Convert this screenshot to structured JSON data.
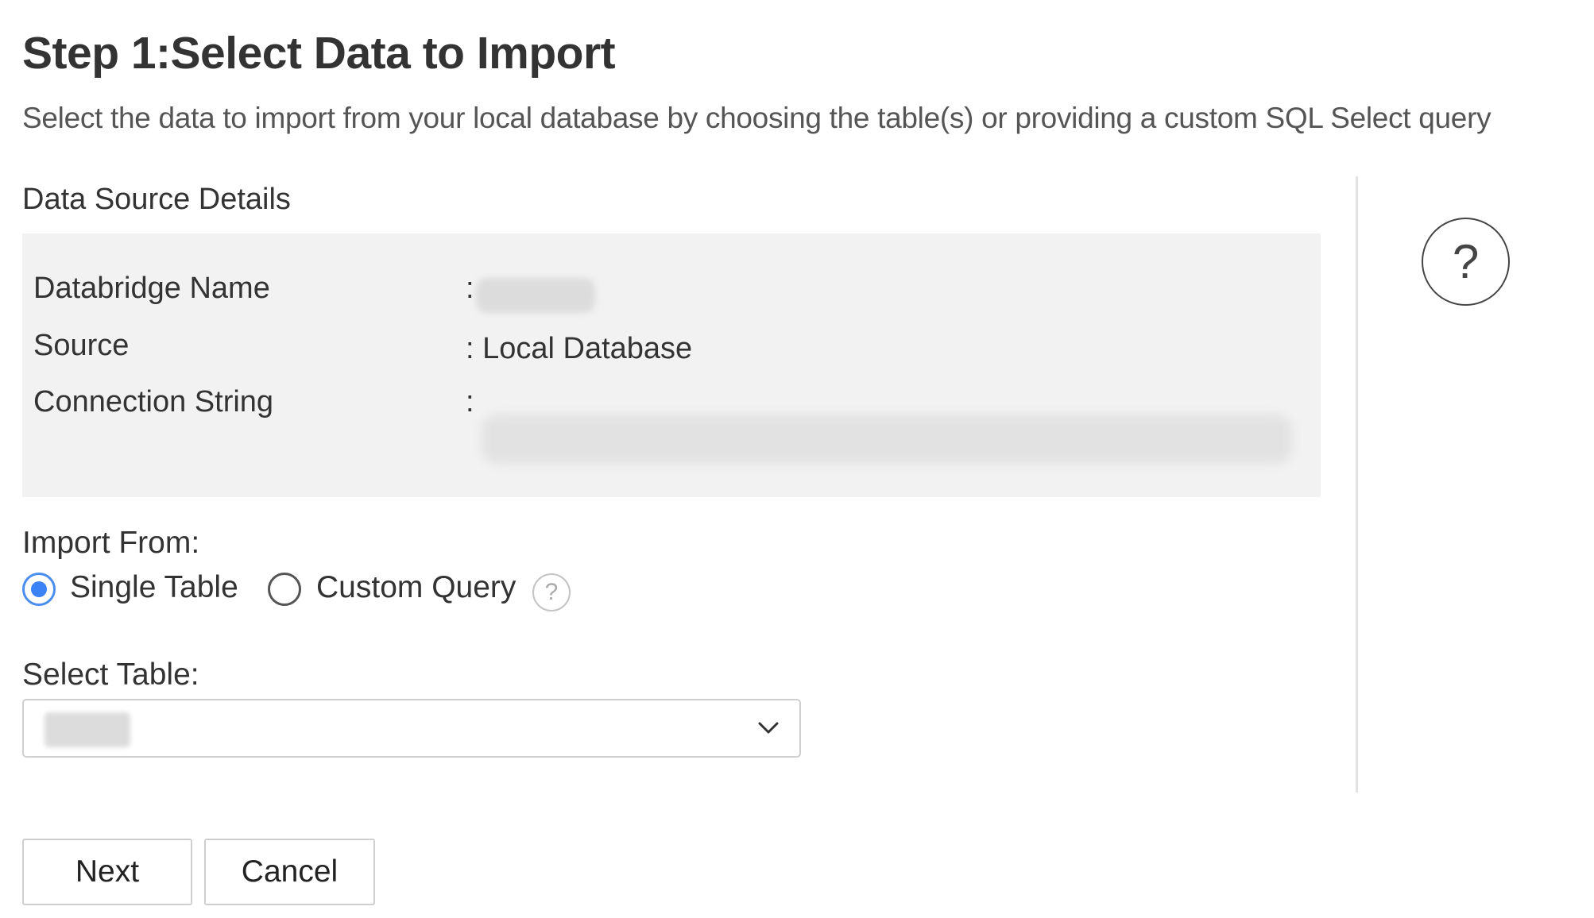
{
  "header": {
    "title": "Step 1:Select Data to Import",
    "subtitle": "Select the data to import from your local database by choosing the table(s) or providing a custom SQL Select query"
  },
  "details": {
    "heading": "Data Source Details",
    "colon": ":",
    "rows": [
      {
        "label": "Databridge Name",
        "value": ""
      },
      {
        "label": "Source",
        "value": ": Local Database"
      },
      {
        "label": "Connection String",
        "value": ""
      }
    ]
  },
  "help": {
    "symbol": "?"
  },
  "import_from": {
    "label": "Import From:",
    "options": [
      {
        "label": "Single Table",
        "checked": true
      },
      {
        "label": "Custom Query",
        "checked": false
      }
    ],
    "help_symbol": "?"
  },
  "select_table": {
    "label": "Select Table:",
    "value": ""
  },
  "buttons": {
    "next": "Next",
    "cancel": "Cancel"
  },
  "colors": {
    "accent": "#3b82f6",
    "panel": "#f2f2f2"
  },
  "icons": {
    "help": "question-circle-icon",
    "dropdown": "chevron-down-icon"
  }
}
